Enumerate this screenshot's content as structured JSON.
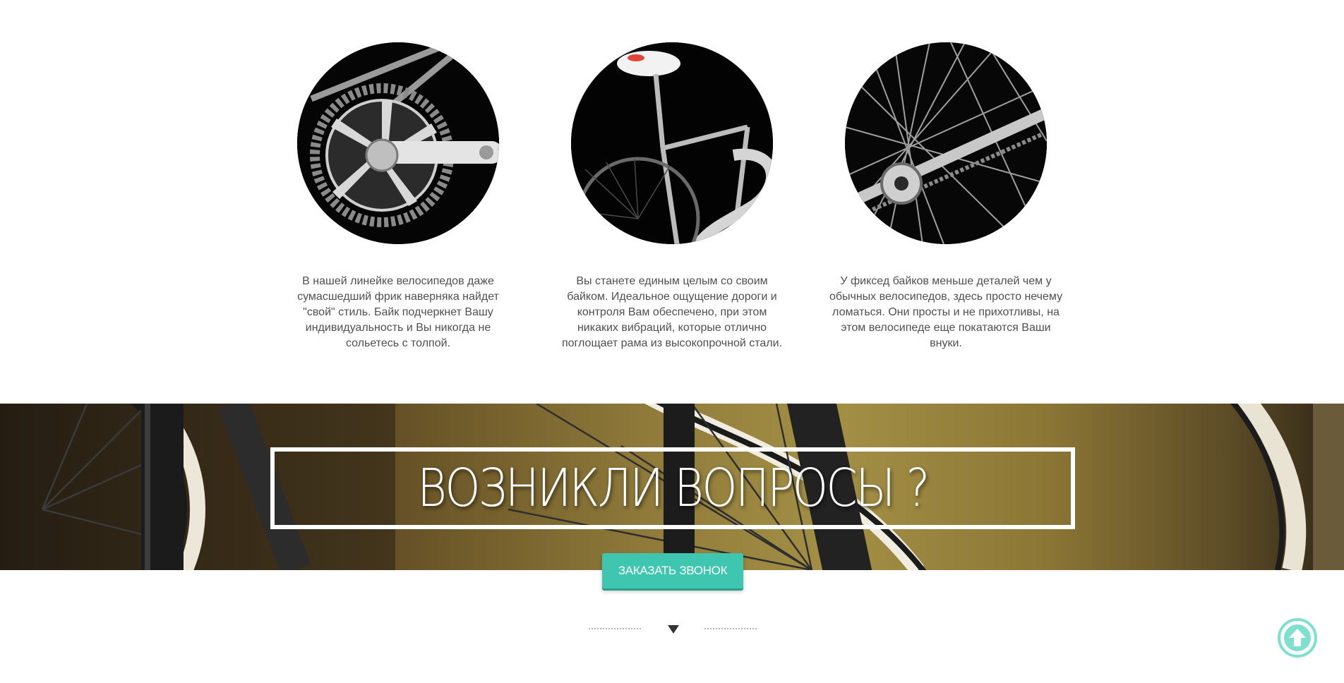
{
  "features": [
    {
      "image_icon": "crankset-photo",
      "lines": [
        "В нашей линейке велосипедов даже",
        "сумасшедший фрик наверняка найдет",
        "\"свой\" стиль. Байк подчеркнет Вашу",
        "индивидуальность и Вы никогда не",
        "сольетесь с толпой."
      ]
    },
    {
      "image_icon": "bike-frame-photo",
      "lines": [
        "Вы станете единым целым со своим",
        "байком. Идеальное ощущение дороги и",
        "контроля Вам обеспечено, при этом",
        "никаких вибраций, которые отлично",
        "поглощает рама из высокопрочной стали."
      ]
    },
    {
      "image_icon": "wheel-spokes-photo",
      "lines": [
        "У фиксед байков меньше деталей чем у",
        "обычных велосипедов, здесь просто нечему",
        "ломаться. Они просты и не прихотливы, на",
        "этом велосипеде еще покатаются Ваши",
        "внуки."
      ]
    }
  ],
  "banner": {
    "heading": "ВОЗНИКЛИ ВОПРОСЫ ?",
    "background_icon": "bike-wheel-photo"
  },
  "cta": {
    "label": "ЗАКАЗАТЬ ЗВОНОК"
  },
  "divider": {
    "icon": "chevron-down-icon"
  },
  "scroll_top": {
    "icon": "arrow-up-icon"
  },
  "colors": {
    "accent": "#3fc6b1",
    "accent_light": "#7fe0d0",
    "text": "#505050",
    "circle_bg": "#050505"
  }
}
